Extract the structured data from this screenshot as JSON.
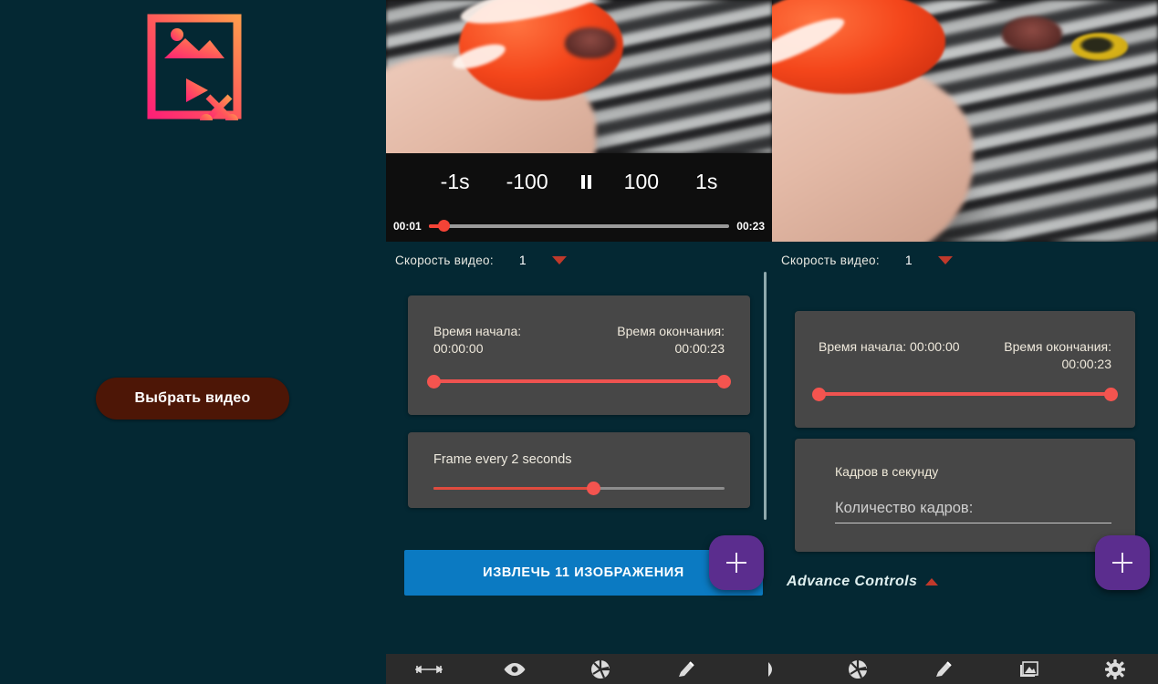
{
  "app": {
    "background_color": "#042833",
    "card_color": "#474747",
    "accent_red": "#f4544f",
    "accent_blue": "#0b7ac2",
    "accent_purple": "#5b2d8e"
  },
  "logo": {
    "name": "video-image-extractor-logo",
    "gradient_from": "#ff2d8a",
    "gradient_to": "#ff9a4d"
  },
  "left_panel": {
    "pick_video_label": "Выбрать видео"
  },
  "player": {
    "back_1s_label": "-1s",
    "back_100_label": "-100",
    "pause_label": "pause",
    "forward_100_label": "100",
    "forward_1s_label": "1s",
    "current_time": "00:01",
    "total_time": "00:23",
    "progress_percent": 5
  },
  "panel_left": {
    "speed_label": "Скорость видео:",
    "speed_value": "1",
    "trim": {
      "start_label": "Время начала:",
      "start_value": "00:00:00",
      "end_label": "Время окончания:",
      "end_value": "00:00:23"
    },
    "frame_interval_label": "Frame every 2 seconds",
    "frame_slider_percent": 55,
    "extract_label": "ИЗВЛЕЧЬ 11 ИЗОБРАЖЕНИЯ",
    "fab_label": "+"
  },
  "panel_right": {
    "speed_label": "Скорость видео:",
    "speed_value": "1",
    "trim": {
      "start_text": "Время начала: 00:00:00",
      "end_text": "Время окончания: 00:00:23"
    },
    "fps_label": "Кадров в секунду",
    "fps_placeholder": "Количество кадров:",
    "fps_value": "",
    "advance_controls_label": "Advance Controls",
    "fab_label": "+"
  },
  "toolbar": {
    "items": [
      {
        "icon": "resize-arrows-icon",
        "name": "tool-resize"
      },
      {
        "icon": "eye-icon",
        "name": "tool-preview"
      },
      {
        "icon": "aperture-icon",
        "name": "tool-camera"
      },
      {
        "icon": "pencil-icon",
        "name": "tool-edit"
      },
      {
        "icon": "play-triangle-icon",
        "name": "tool-play"
      },
      {
        "icon": "aperture-icon",
        "name": "tool-camera-2"
      },
      {
        "icon": "pencil-icon",
        "name": "tool-edit-2"
      },
      {
        "icon": "image-icon",
        "name": "tool-gallery"
      },
      {
        "icon": "gear-icon",
        "name": "tool-settings"
      }
    ]
  }
}
